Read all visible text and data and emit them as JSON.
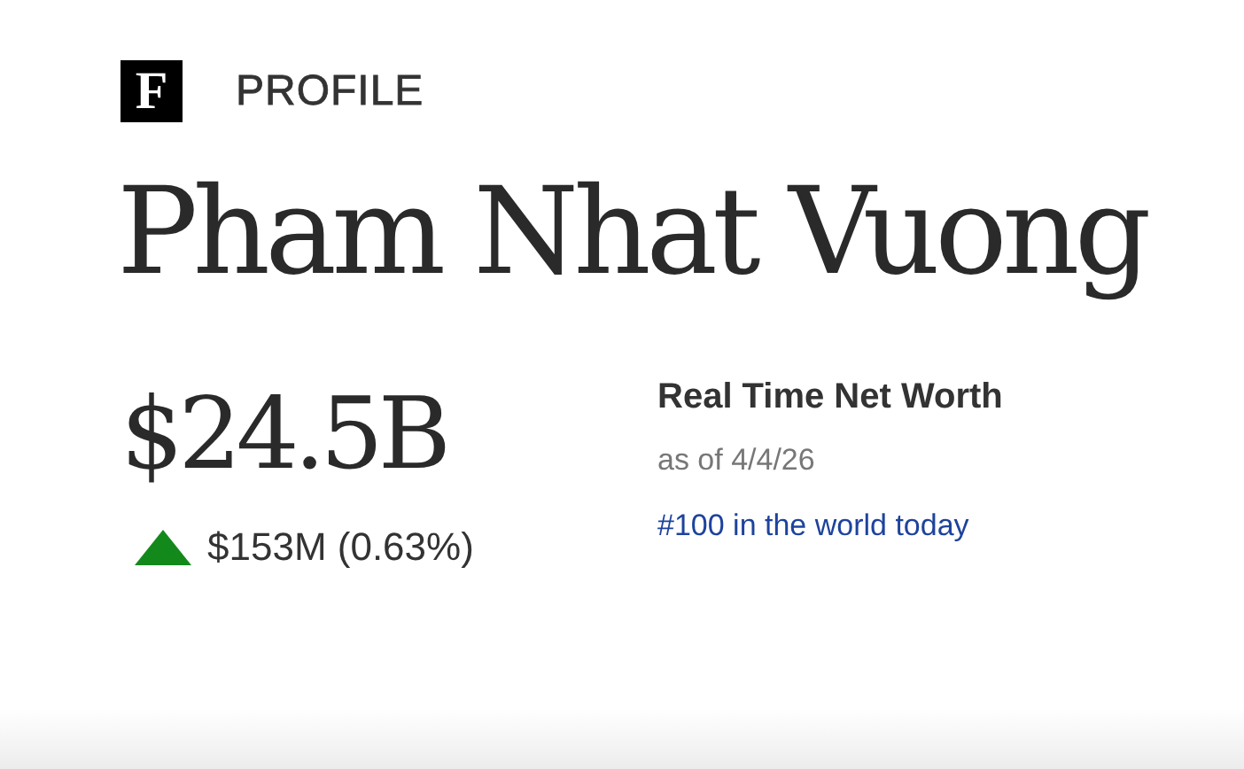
{
  "header": {
    "logo": "F",
    "section": "PROFILE"
  },
  "name": "Pham Nhat Vuong",
  "net_worth": {
    "value": "$24.5B",
    "change": {
      "kind": "gain",
      "text": "$153M (0.63%)"
    }
  },
  "details": {
    "title": "Real Time Net Worth",
    "as_of": "as of 4/4/26",
    "rank": "#100 in the world today"
  }
}
